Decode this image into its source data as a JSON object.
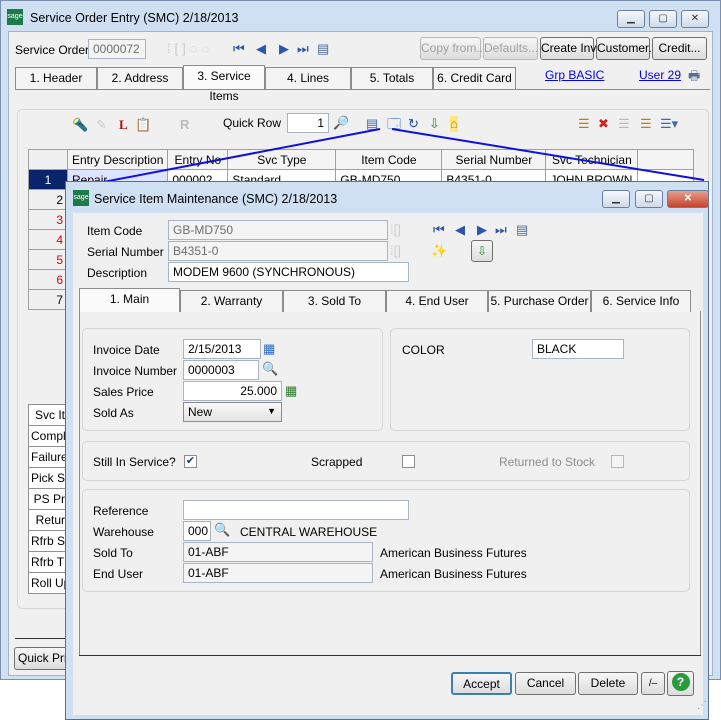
{
  "main_window": {
    "title": "Service Order Entry (SMC) 2/18/2013",
    "service_order_label": "Service Order",
    "service_order_value": "0000072",
    "buttons": {
      "copy_from": "Copy from...",
      "defaults": "Defaults...",
      "create_inv": "Create Inv",
      "customer": "Customer...",
      "credit": "Credit..."
    },
    "tabs": [
      "1. Header",
      "2. Address",
      "3. Service Items",
      "4. Lines",
      "5. Totals",
      "6. Credit Card"
    ],
    "active_tab": "3. Service Items",
    "links": {
      "grp": "Grp BASIC",
      "user": "User 29"
    },
    "quick_row_label": "Quick Row",
    "quick_row_value": "1",
    "grid": {
      "columns": [
        "Entry Description",
        "Entry No",
        "Svc Type",
        "Item Code",
        "Serial Number",
        "Svc Technician"
      ],
      "rows": [
        {
          "num": "1",
          "cells": [
            "Repair",
            "000002",
            "Standard",
            "GB-MD750",
            "B4351-0",
            "JOHN BROWN"
          ]
        },
        {
          "num": "2",
          "cells": []
        },
        {
          "num": "3",
          "cells": []
        },
        {
          "num": "4",
          "cells": []
        },
        {
          "num": "5",
          "cells": []
        },
        {
          "num": "6",
          "cells": []
        },
        {
          "num": "7",
          "cells": []
        }
      ]
    },
    "side_labels": [
      "Svc It",
      "Compl",
      "Failure",
      "Pick S",
      "PS Pr",
      "Retur",
      "Rfrb S",
      "Rfrb T",
      "Roll Up"
    ],
    "quick_print": "Quick Prir"
  },
  "dialog": {
    "title": "Service Item Maintenance (SMC) 2/18/2013",
    "item_code_label": "Item Code",
    "item_code": "GB-MD750",
    "serial_label": "Serial Number",
    "serial": "B4351-0",
    "description_label": "Description",
    "description": "MODEM 9600 (SYNCHRONOUS)",
    "tabs": [
      "1. Main",
      "2. Warranty",
      "3. Sold To",
      "4. End User",
      "5. Purchase Order",
      "6. Service Info"
    ],
    "active_tab": "1. Main",
    "invoice_date_label": "Invoice Date",
    "invoice_date": "2/15/2013",
    "invoice_number_label": "Invoice Number",
    "invoice_number": "0000003",
    "sales_price_label": "Sales Price",
    "sales_price": "25.000",
    "sold_as_label": "Sold As",
    "sold_as": "New",
    "color_label": "COLOR",
    "color_value": "BLACK",
    "still_in_service_label": "Still In Service?",
    "still_in_service": true,
    "scrapped_label": "Scrapped",
    "scrapped": false,
    "returned_label": "Returned to Stock",
    "returned": false,
    "reference_label": "Reference",
    "reference": "",
    "warehouse_label": "Warehouse",
    "warehouse": "000",
    "warehouse_name": "CENTRAL WAREHOUSE",
    "sold_to_label": "Sold To",
    "sold_to": "01-ABF",
    "sold_to_name": "American Business Futures",
    "end_user_label": "End User",
    "end_user": "01-ABF",
    "end_user_name": "American Business Futures",
    "buttons": {
      "accept": "Accept",
      "cancel": "Cancel",
      "delete": "Delete",
      "small": "/‒",
      "help": "?"
    }
  },
  "colors": {
    "selection": "#0a246a",
    "link": "#0000ee",
    "connector": "#1010e0",
    "required_row": "#e00000"
  }
}
